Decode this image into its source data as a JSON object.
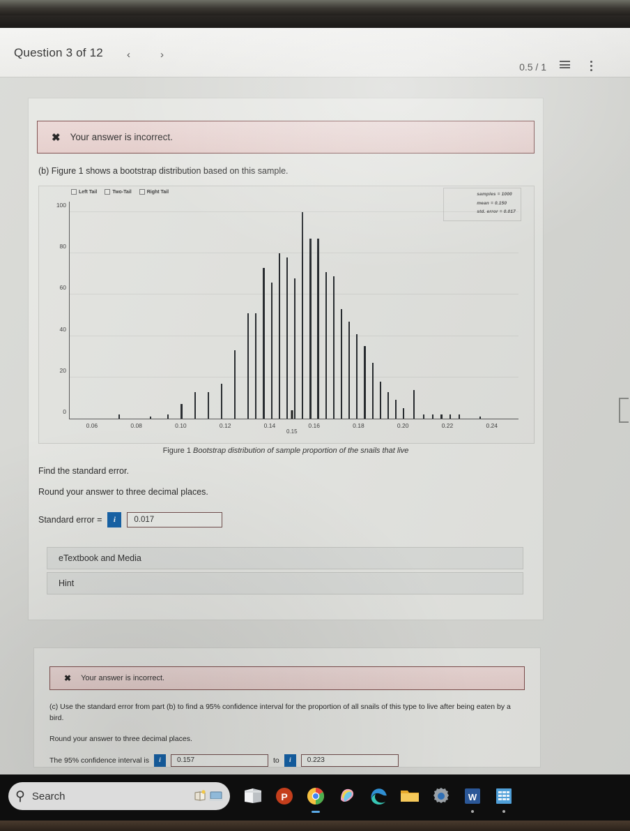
{
  "header": {
    "title": "Question 3 of 12",
    "prev_label": "‹",
    "next_label": "›",
    "score": "0.5 / 1",
    "list_icon": "list-icon",
    "kebab_icon": "more-options-icon"
  },
  "part_b": {
    "alert": {
      "icon": "✖",
      "message": "Your answer is incorrect."
    },
    "prompt": "(b) Figure 1 shows a bootstrap distribution based on this sample.",
    "instruction_1": "Find the standard error.",
    "instruction_2": "Round your answer to three decimal places.",
    "answer_label": "Standard error  =",
    "info_icon_label": "i",
    "answer_value": "0.017",
    "etextbook_label": "eTextbook and Media",
    "hint_label": "Hint"
  },
  "part_c": {
    "alert": {
      "icon": "✖",
      "message": "Your answer is incorrect."
    },
    "prompt": "(c) Use the standard error from part (b) to find a 95% confidence interval for the proportion of all snails of this type to live after being eaten by a bird.",
    "instruction": "Round your answer to three decimal places.",
    "ci_label": "The 95% confidence interval is",
    "ci_lower": "0.157",
    "ci_between": "to",
    "ci_upper": "0.223",
    "info_icon_label": "i"
  },
  "chart_data": {
    "type": "bar",
    "title": "",
    "caption_prefix": "Figure 1",
    "caption": "Bootstrap distribution of sample proportion of the snails that live",
    "xlabel": "",
    "ylabel": "",
    "xlim": [
      0.05,
      0.252
    ],
    "ylim": [
      0,
      105
    ],
    "yticks": [
      0,
      20,
      40,
      60,
      80,
      100
    ],
    "xticks": [
      0.06,
      0.08,
      0.1,
      0.12,
      0.14,
      0.16,
      0.18,
      0.2,
      0.22,
      0.24
    ],
    "xtick_labels": [
      "0.06",
      "0.08",
      "0.10",
      "0.12",
      "0.14",
      "0.16",
      "0.18",
      "0.20",
      "0.22",
      "0.24"
    ],
    "grid": true,
    "marker": {
      "x": 0.15,
      "label": "0.15"
    },
    "legend_position": "top-left",
    "legend": [
      {
        "label": "Left Tail",
        "checked": false
      },
      {
        "label": "Two-Tail",
        "checked": false
      },
      {
        "label": "Right Tail",
        "checked": false
      }
    ],
    "stats": [
      "samples = 1000",
      "mean = 0.150",
      "std. error = 0.017"
    ],
    "x": [
      0.072,
      0.086,
      0.094,
      0.1,
      0.106,
      0.112,
      0.118,
      0.124,
      0.13,
      0.1335,
      0.137,
      0.1405,
      0.144,
      0.1475,
      0.151,
      0.1545,
      0.158,
      0.1615,
      0.165,
      0.1685,
      0.172,
      0.1755,
      0.179,
      0.1825,
      0.186,
      0.1895,
      0.193,
      0.1965,
      0.2,
      0.2045,
      0.209,
      0.213,
      0.217,
      0.221,
      0.225,
      0.2345
    ],
    "values": [
      2,
      1,
      2,
      7,
      13,
      13,
      17,
      33,
      51,
      51,
      73,
      66,
      80,
      78,
      68,
      100,
      87,
      87,
      71,
      69,
      53,
      47,
      41,
      35,
      27,
      18,
      13,
      9,
      5,
      14,
      2,
      2,
      2,
      2,
      2,
      1
    ]
  },
  "taskbar": {
    "search_placeholder": "Search",
    "search_icon": "search-icon",
    "items": [
      {
        "name": "widgets-icon"
      },
      {
        "name": "file-explorer-icon"
      },
      {
        "name": "powerpoint-icon"
      },
      {
        "name": "chrome-icon"
      },
      {
        "name": "photos-icon"
      },
      {
        "name": "edge-icon"
      },
      {
        "name": "folder-icon"
      },
      {
        "name": "settings-icon"
      },
      {
        "name": "word-icon"
      },
      {
        "name": "excel-icon"
      }
    ]
  }
}
